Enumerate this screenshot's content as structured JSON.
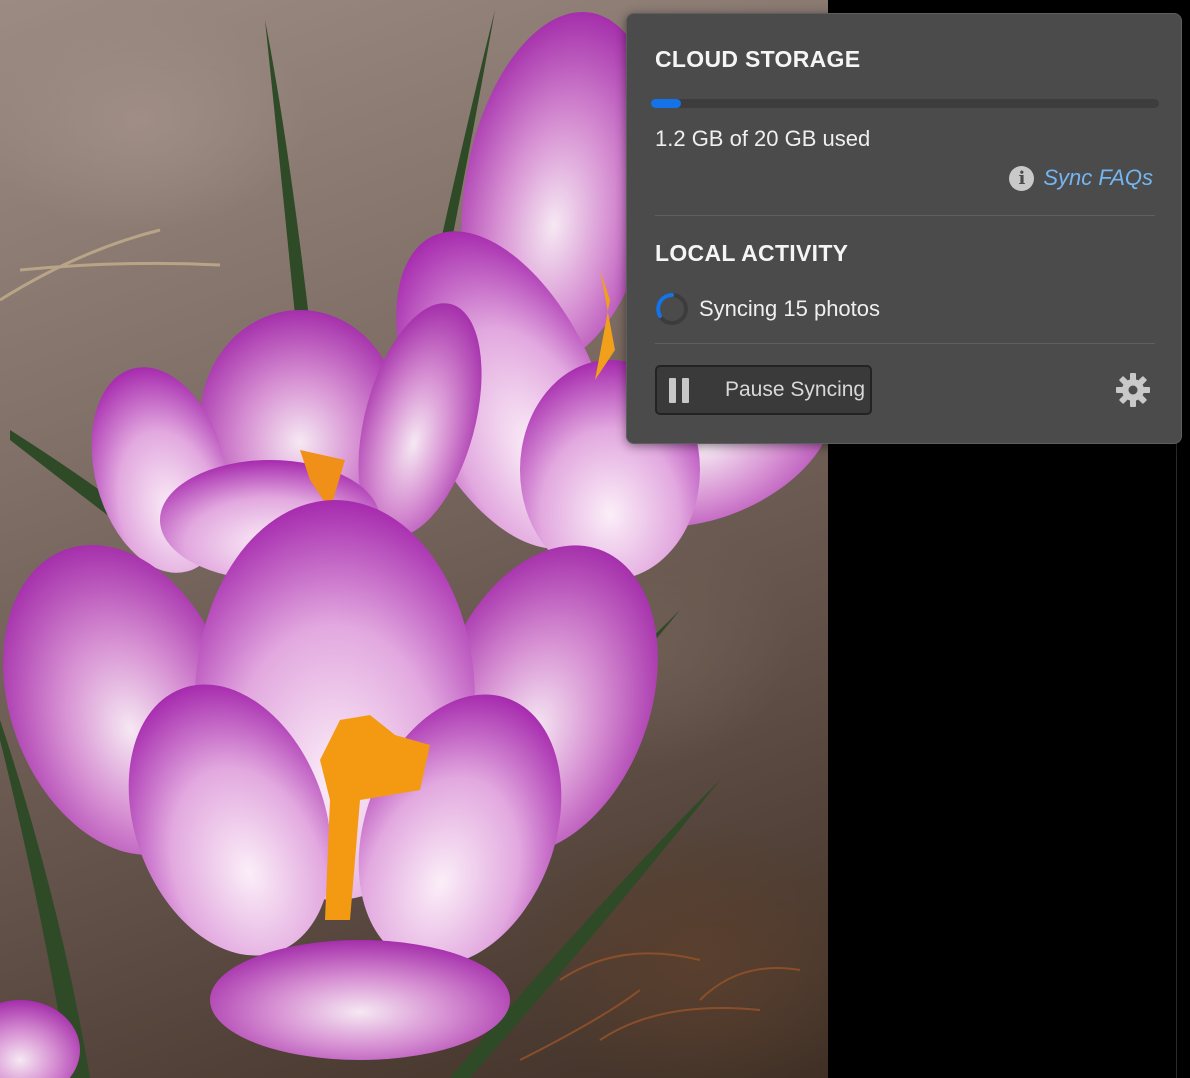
{
  "colors": {
    "panel_bg": "#4b4b4b",
    "accent": "#1473e6",
    "link": "#74b6f2",
    "spinner": "#1473e6"
  },
  "photo": {
    "subject": "purple-and-white striped crocus flowers photo",
    "icon": "crocus-photo"
  },
  "cloud_storage": {
    "title": "CLOUD STORAGE",
    "used_fraction": 0.06,
    "usage_text": "1.2 GB of 20 GB used",
    "faq_icon": "info-icon",
    "faq_label": "Sync FAQs"
  },
  "local_activity": {
    "title": "LOCAL ACTIVITY",
    "status_icon": "spinner-icon",
    "status_text": "Syncing 15 photos"
  },
  "actions": {
    "pause_icon": "pause-icon",
    "pause_label": "Pause Syncing",
    "settings_icon": "gear-icon"
  }
}
